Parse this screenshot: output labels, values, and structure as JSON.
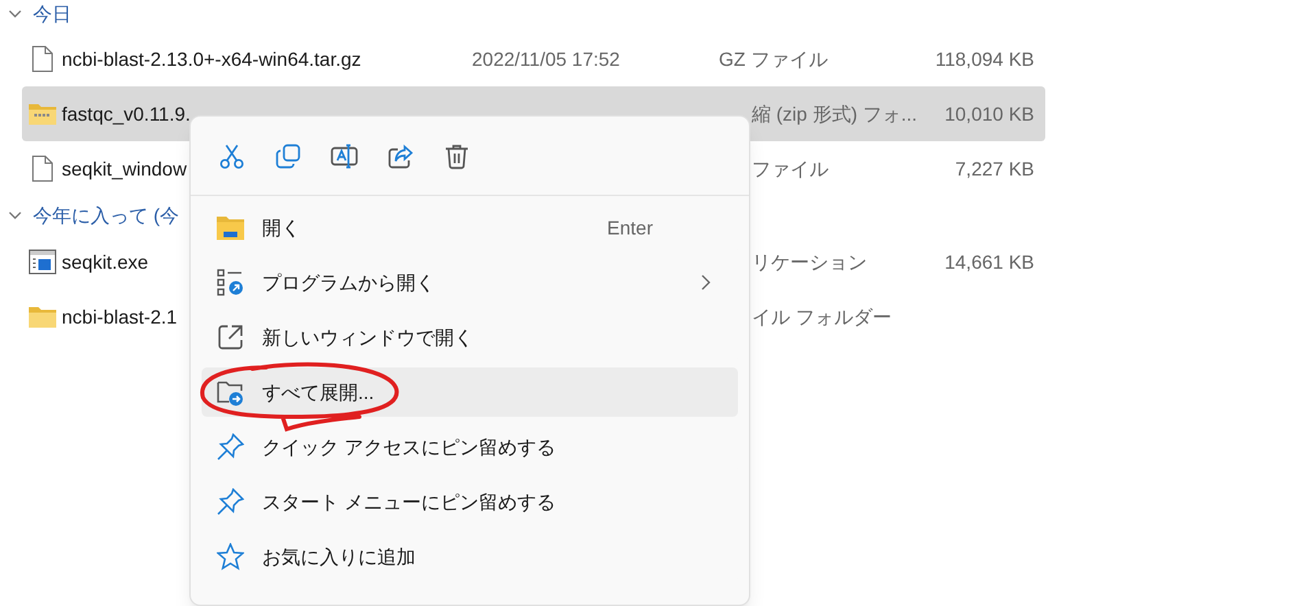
{
  "groups": [
    {
      "title": "今日",
      "expanded": true,
      "rows": [
        {
          "kind": "document",
          "name": "ncbi-blast-2.13.0+-x64-win64.tar.gz",
          "date": "2022/11/05 17:52",
          "type": "GZ ファイル",
          "size": "118,094 KB",
          "selected": false
        },
        {
          "kind": "zip",
          "name": "fastqc_v0.11.9.",
          "type": "縮 (zip 形式) フォ...",
          "size": "10,010 KB",
          "selected": true
        },
        {
          "kind": "document",
          "name": "seqkit_window",
          "type": "ファイル",
          "size": "7,227 KB",
          "selected": false
        }
      ]
    },
    {
      "title": "今年に入って (今",
      "expanded": true,
      "rows": [
        {
          "kind": "exe",
          "name": "seqkit.exe",
          "type": "リケーション",
          "size": "14,661 KB",
          "selected": false
        },
        {
          "kind": "folder",
          "name": "ncbi-blast-2.1",
          "type": "イル フォルダー",
          "selected": false
        }
      ]
    }
  ],
  "context_menu": {
    "items": [
      {
        "kind": "open",
        "label": "開く",
        "shortcut": "Enter",
        "submenu": false,
        "highlighted": false
      },
      {
        "kind": "open-with",
        "label": "プログラムから開く",
        "submenu": true,
        "highlighted": false
      },
      {
        "kind": "new-window",
        "label": "新しいウィンドウで開く",
        "submenu": false,
        "highlighted": false
      },
      {
        "kind": "extract",
        "label": "すべて展開...",
        "submenu": false,
        "highlighted": true
      },
      {
        "kind": "pin",
        "label": "クイック アクセスにピン留めする",
        "submenu": false,
        "highlighted": false
      },
      {
        "kind": "pin",
        "label": "スタート メニューにピン留めする",
        "submenu": false,
        "highlighted": false
      },
      {
        "kind": "star",
        "label": "お気に入りに追加",
        "submenu": false,
        "highlighted": false
      }
    ]
  }
}
